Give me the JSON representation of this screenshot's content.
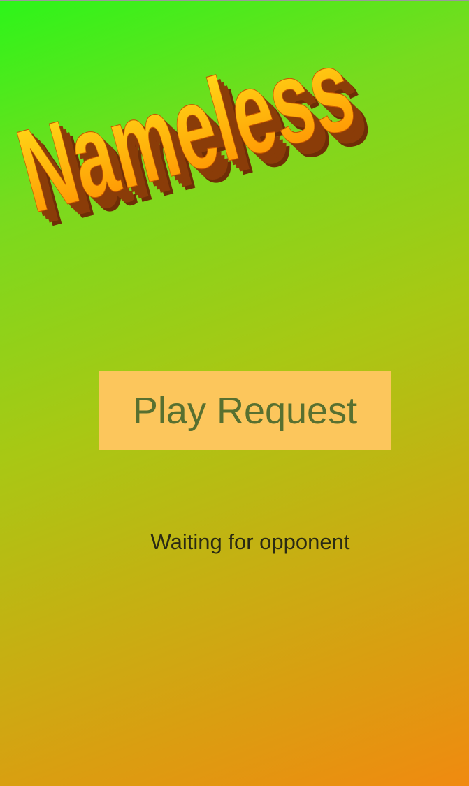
{
  "app": {
    "logo_text": "Nameless",
    "logo_colors": {
      "fill_top": "#ffe21a",
      "fill_bottom": "#ff8a00",
      "extrusion": "#8a3c08"
    }
  },
  "main": {
    "play_button_label": "Play Request",
    "status_text": "Waiting for opponent"
  },
  "colors": {
    "background_top": "#2cf51a",
    "background_bottom": "#f08a10",
    "button_bg": "#fcc65c",
    "button_text": "#587030",
    "status_text": "#2a2a14"
  }
}
